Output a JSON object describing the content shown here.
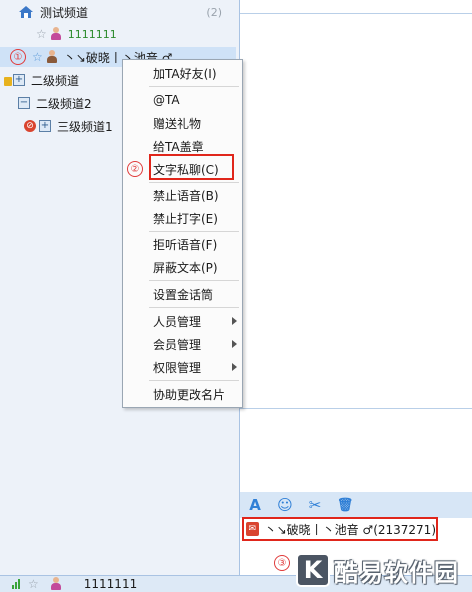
{
  "tree": {
    "root": {
      "name": "测试频道",
      "count": "(2)"
    },
    "user1": {
      "id": "1111111"
    },
    "selected_user": {
      "name": "丶↘破晓丨丶池音 ♂"
    },
    "sub1": {
      "name": "二级频道"
    },
    "sub2": {
      "name": "二级频道2"
    },
    "sub3": {
      "name": "三级频道1"
    }
  },
  "menu": {
    "items": [
      {
        "label": "加TA好友(I)"
      },
      {
        "label": "@TA"
      },
      {
        "label": "赠送礼物"
      },
      {
        "label": "给TA盖章"
      },
      {
        "label": "文字私聊(C)"
      },
      {
        "label": "禁止语音(B)"
      },
      {
        "label": "禁止打字(E)"
      },
      {
        "label": "拒听语音(F)"
      },
      {
        "label": "屏蔽文本(P)"
      },
      {
        "label": "设置金话筒"
      },
      {
        "label": "人员管理"
      },
      {
        "label": "会员管理"
      },
      {
        "label": "权限管理"
      },
      {
        "label": "协助更改名片"
      }
    ]
  },
  "markers": {
    "one": "①",
    "two": "②",
    "three": "③"
  },
  "chat_target": {
    "label": "丶↘破晓丨丶池音 ♂(2137271)"
  },
  "toolbar": {
    "font": "A",
    "emoji": "☺",
    "scissors": "✂",
    "trash": "🗑"
  },
  "status": {
    "id": "1111111"
  },
  "watermark": {
    "logo_letter": "K",
    "text": "酷易软件园"
  },
  "colors": {
    "highlight": "#e0261b",
    "toolbar_bg": "#d7e6f6",
    "selected_row": "#cfe2f7"
  }
}
